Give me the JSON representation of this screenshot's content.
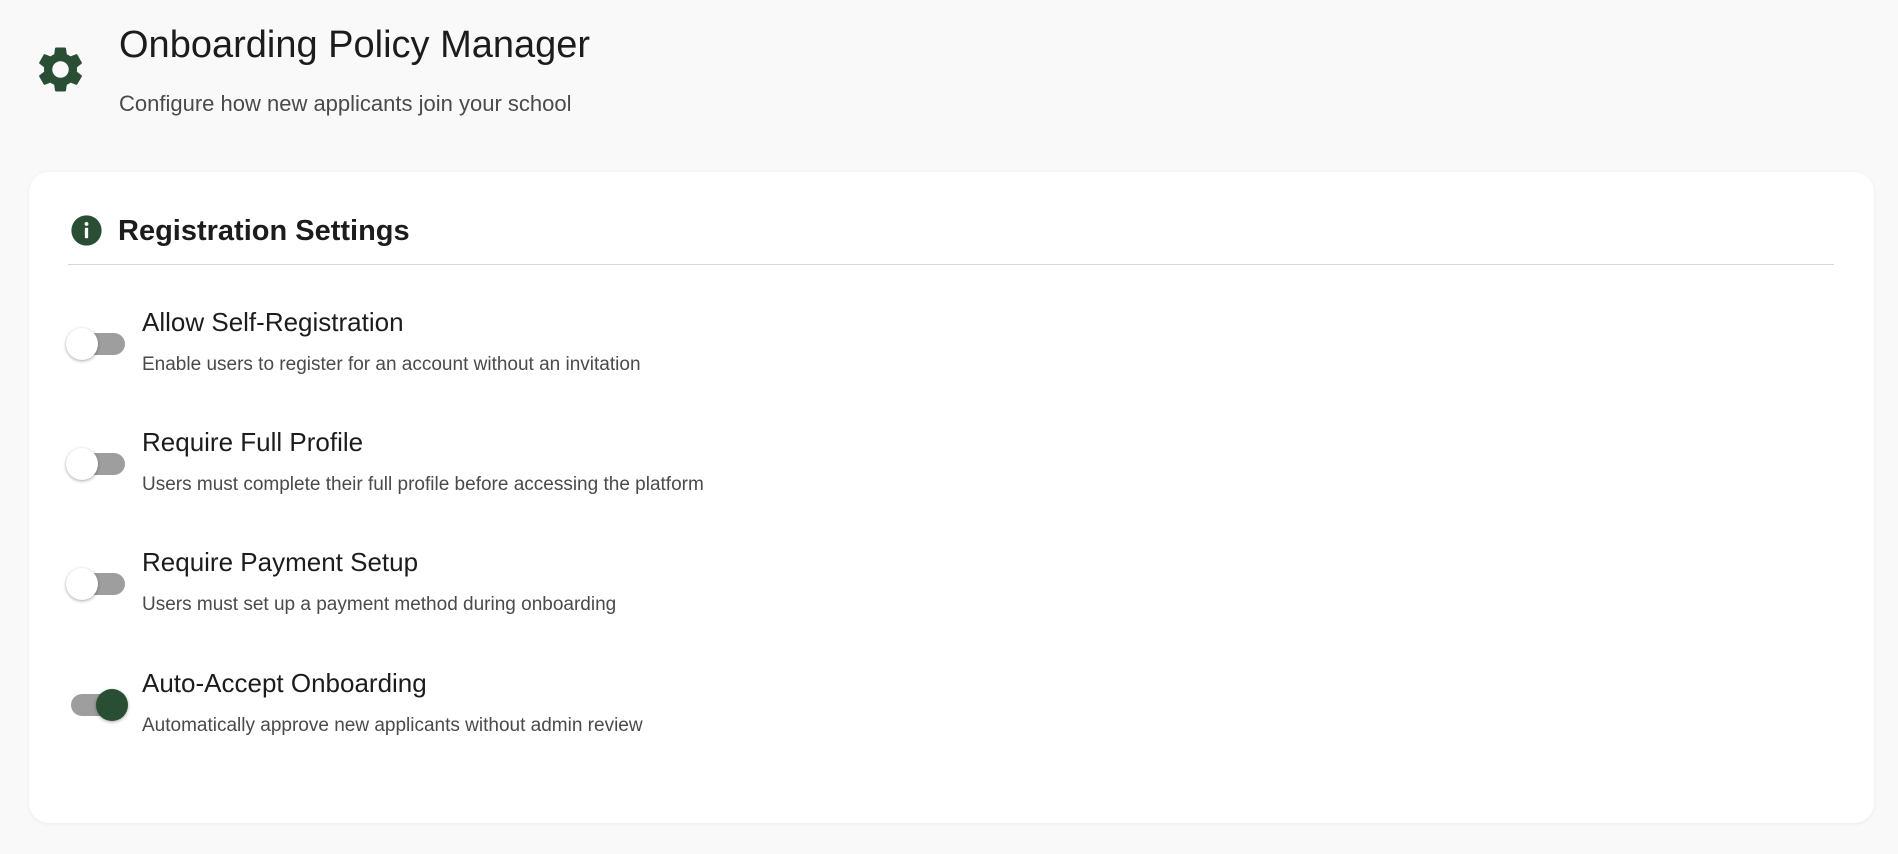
{
  "header": {
    "title": "Onboarding Policy Manager",
    "subtitle": "Configure how new applicants join your school",
    "icon": "gear-icon"
  },
  "section": {
    "title": "Registration Settings",
    "icon": "info-icon"
  },
  "colors": {
    "accent": "#2a4e34",
    "track": "#9e9e9e",
    "background": "#f9f9f9",
    "card": "#ffffff"
  },
  "settings": [
    {
      "label": "Allow Self-Registration",
      "description": "Enable users to register for an account without an invitation",
      "enabled": false
    },
    {
      "label": "Require Full Profile",
      "description": "Users must complete their full profile before accessing the platform",
      "enabled": false
    },
    {
      "label": "Require Payment Setup",
      "description": "Users must set up a payment method during onboarding",
      "enabled": false
    },
    {
      "label": "Auto-Accept Onboarding",
      "description": "Automatically approve new applicants without admin review",
      "enabled": true
    }
  ]
}
